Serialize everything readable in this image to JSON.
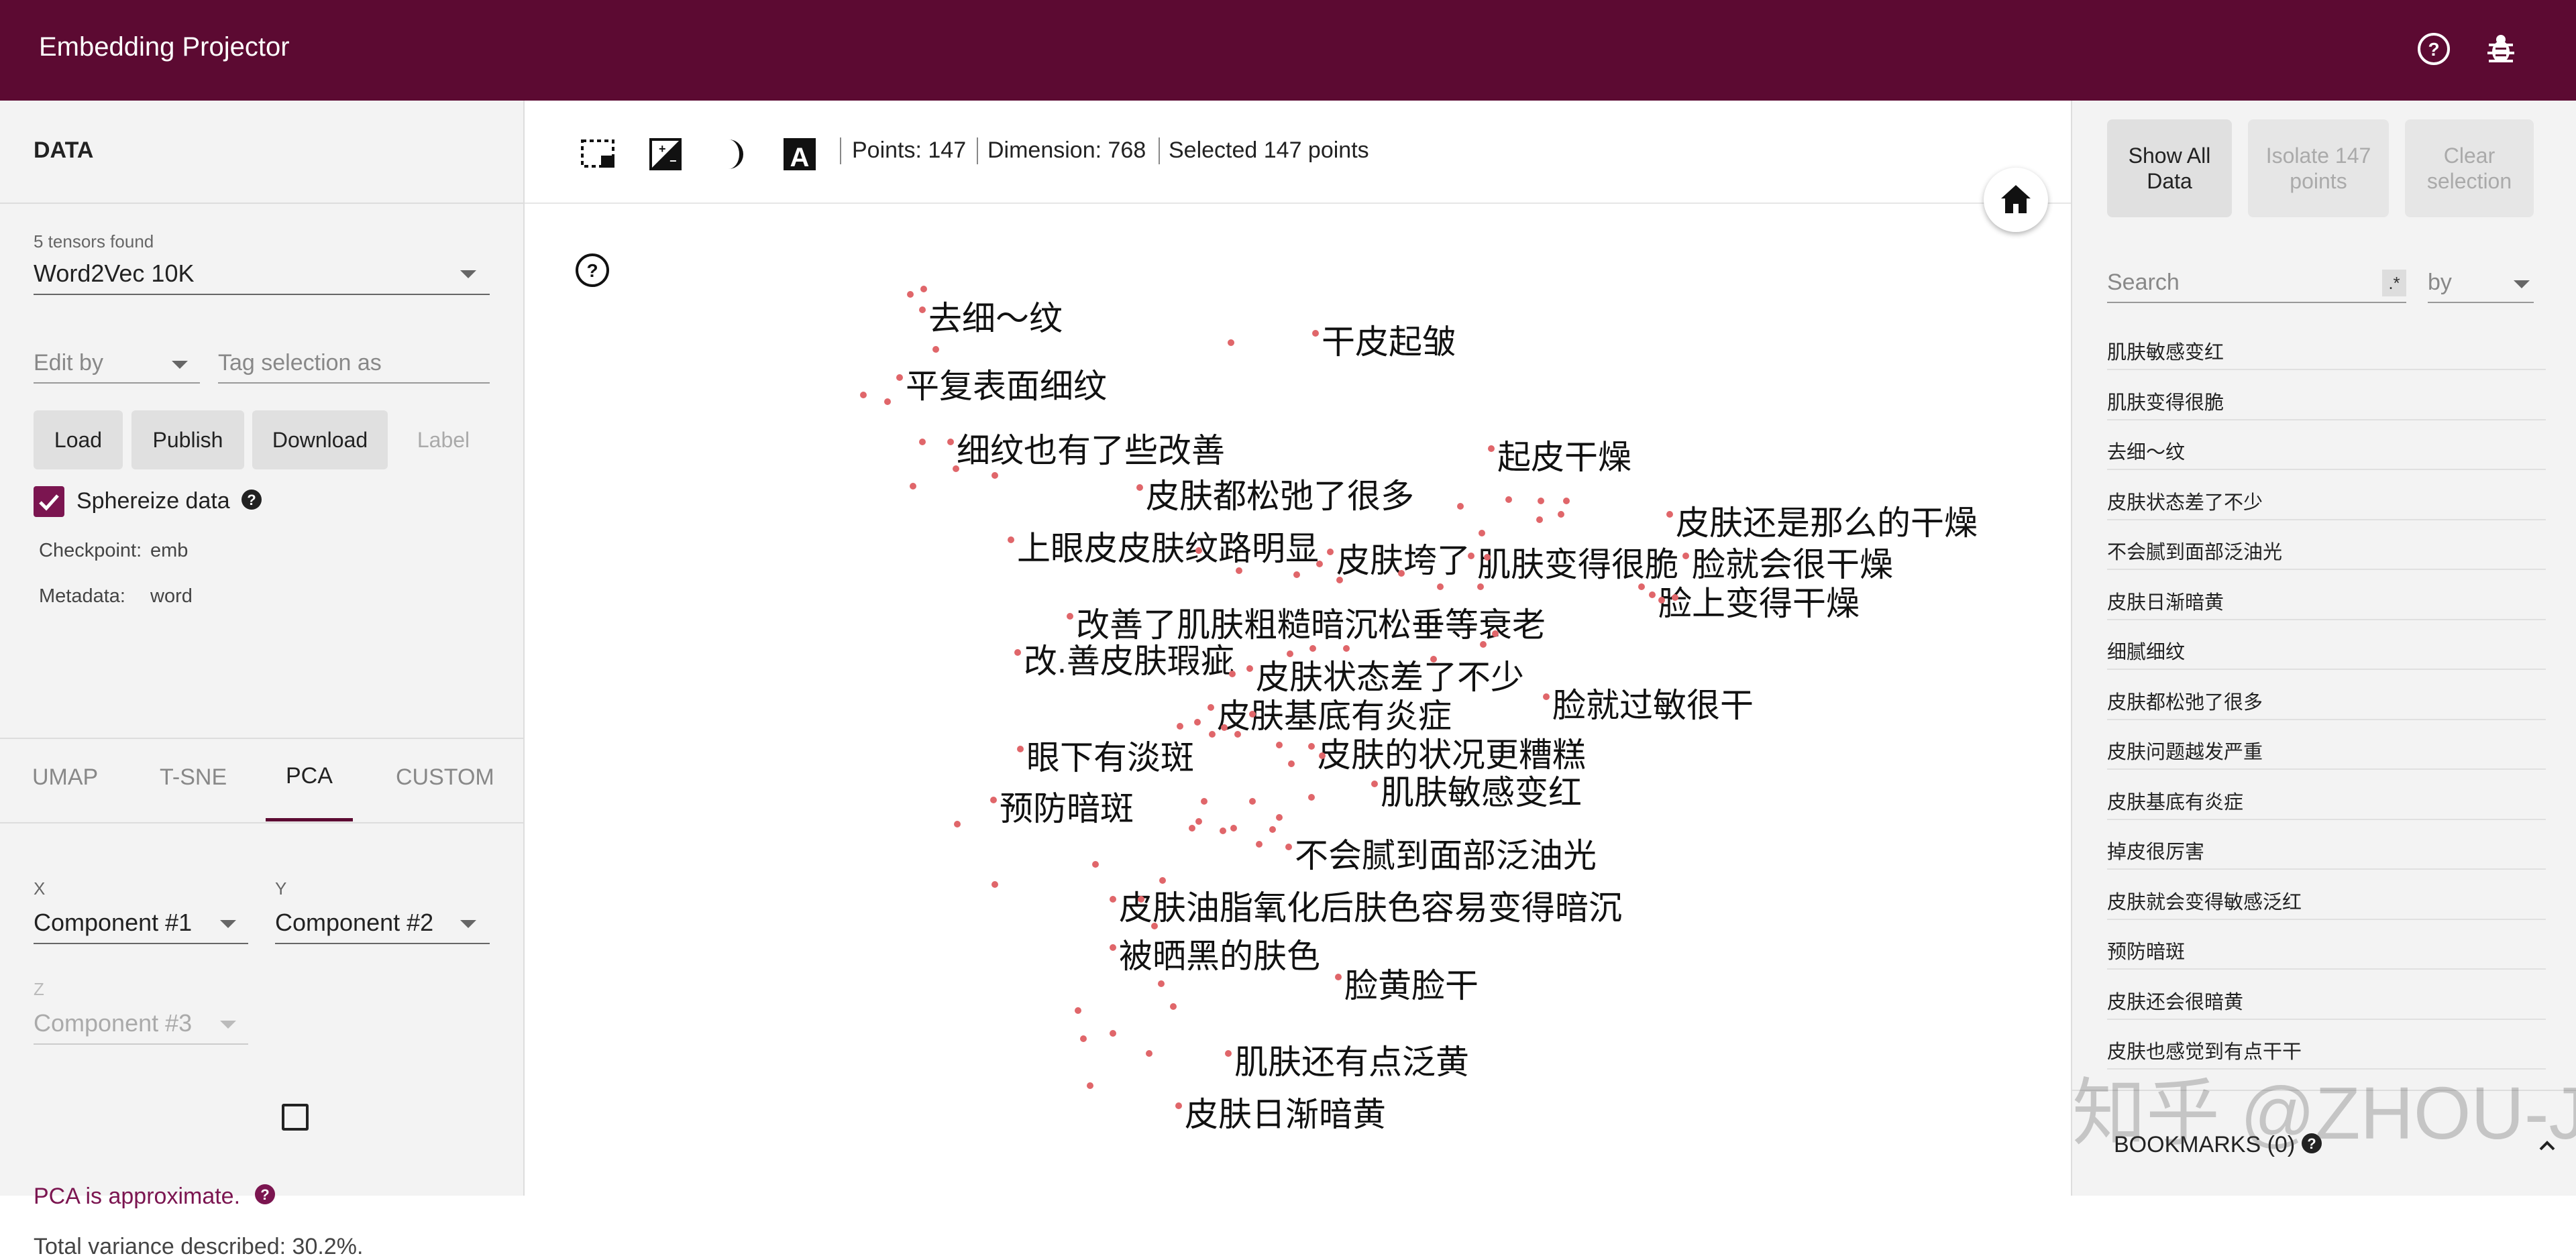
{
  "header": {
    "title": "Embedding Projector",
    "help_icon": "help-circle-icon",
    "bug_icon": "bug-icon"
  },
  "left": {
    "data_title": "DATA",
    "tensors_found": "5 tensors found",
    "tensor_selected": "Word2Vec 10K",
    "edit_by_placeholder": "Edit by",
    "tag_selection_placeholder": "Tag selection as",
    "buttons": {
      "load": "Load",
      "publish": "Publish",
      "download": "Download",
      "label": "Label"
    },
    "sphereize_label": "Sphereize data",
    "sphereize_checked": true,
    "checkpoint_label": "Checkpoint:",
    "checkpoint_value": "emb",
    "metadata_label": "Metadata:",
    "metadata_value": "word",
    "tabs": [
      "UMAP",
      "T-SNE",
      "PCA",
      "CUSTOM"
    ],
    "active_tab": "PCA",
    "x_label": "X",
    "x_value": "Component #1",
    "y_label": "Y",
    "y_value": "Component #2",
    "z_label": "Z",
    "z_value": "Component #3",
    "pca_note": "PCA is approximate.",
    "variance": "Total variance described: 30.2%.",
    "accent_color": "#7b1550"
  },
  "toolbar": {
    "points": "Points: 147",
    "dimension": "Dimension: 768",
    "selected": "Selected 147 points"
  },
  "points": [
    {
      "label": "去细～纹"
    },
    {
      "label": "干皮起皱"
    },
    {
      "label": "平复表面细纹"
    },
    {
      "label": "细纹也有了些改善"
    },
    {
      "label": "起皮干燥"
    },
    {
      "label": "皮肤都松弛了很多"
    },
    {
      "label": "皮肤还是那么的干燥"
    },
    {
      "label": "上眼皮皮肤纹路明显"
    },
    {
      "label": "皮肤垮了"
    },
    {
      "label": "肌肤变得很脆"
    },
    {
      "label": "脸就会很干燥"
    },
    {
      "label": "脸上变得干燥"
    },
    {
      "label": "改善了肌肤粗糙暗沉松垂等衰老"
    },
    {
      "label": "改.善皮肤瑕疵"
    },
    {
      "label": "皮肤状态差了不少"
    },
    {
      "label": "脸就过敏很干"
    },
    {
      "label": "皮肤基底有炎症"
    },
    {
      "label": "眼下有淡斑"
    },
    {
      "label": "皮肤的状况更糟糕"
    },
    {
      "label": "肌肤敏感变红"
    },
    {
      "label": "预防暗斑"
    },
    {
      "label": "不会腻到面部泛油光"
    },
    {
      "label": "皮肤油脂氧化后肤色容易变得暗沉"
    },
    {
      "label": "被晒黑的肤色"
    },
    {
      "label": "脸黄脸干"
    },
    {
      "label": "肌肤还有点泛黄"
    },
    {
      "label": "皮肤日渐暗黄"
    }
  ],
  "right": {
    "show_all": "Show All Data",
    "isolate": "Isolate 147 points",
    "clear": "Clear selection",
    "search_placeholder": "Search",
    "regex": ".*",
    "by": "by",
    "list": [
      "肌肤敏感变红",
      "肌肤变得很脆",
      "去细～纹",
      "皮肤状态差了不少",
      "不会腻到面部泛油光",
      "皮肤日渐暗黄",
      "细腻细纹",
      "皮肤都松弛了很多",
      "皮肤问题越发严重",
      "皮肤基底有炎症",
      "掉皮很厉害",
      "皮肤就会变得敏感泛红",
      "预防暗斑",
      "皮肤还会很暗黄",
      "皮肤也感觉到有点干干"
    ],
    "bookmarks": "BOOKMARKS (0)",
    "watermark": "知乎 @ZHOU-JC"
  },
  "colors": {
    "header_bg": "#5c0a32",
    "dot": "#e0666a"
  }
}
